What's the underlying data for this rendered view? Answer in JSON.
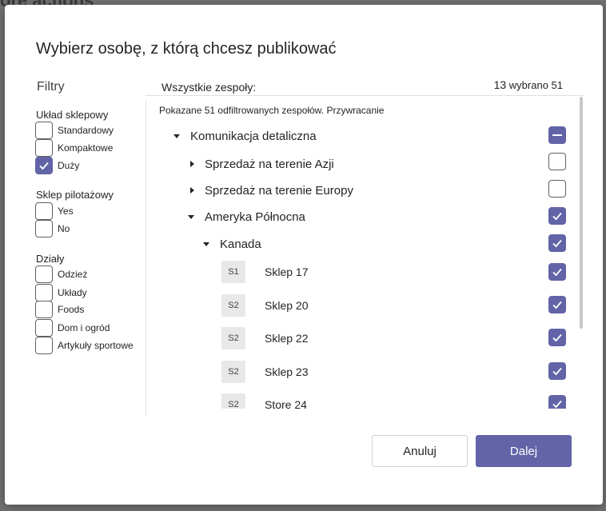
{
  "backdrop": {
    "text": "ore actions"
  },
  "dialog": {
    "title": "Wybierz osobę, z którą chcesz publikować",
    "filters": {
      "title": "Filtry",
      "groups": [
        {
          "title": "Układ sklepowy",
          "options": [
            {
              "label": "Standardowy",
              "checked": false
            },
            {
              "label": "Kompaktowe",
              "checked": false
            },
            {
              "label": "Duży",
              "checked": true
            }
          ]
        },
        {
          "title": "Sklep pilotażowy",
          "options": [
            {
              "label": "Yes",
              "checked": false
            },
            {
              "label": "No",
              "checked": false
            }
          ]
        },
        {
          "title": "Działy",
          "options": [
            {
              "label": "Odzież",
              "checked": false
            },
            {
              "label": "Układy",
              "checked": false
            },
            {
              "label": "Foods",
              "checked": false
            },
            {
              "label": "Dom i ogród",
              "checked": false
            },
            {
              "label": "Artykuły sportowe",
              "checked": false
            }
          ]
        }
      ]
    },
    "teams": {
      "header": "Wszystkie zespoły:",
      "selected_count": "13",
      "selected_suffix": "wybrano 51",
      "shown_info": "Pokazane 51 odfiltrowanych zespołów. Przywracanie",
      "tree": [
        {
          "label": "Komunikacja detaliczna",
          "state": "partial",
          "expanded": true
        },
        {
          "label": "Sprzedaż na terenie Azji",
          "state": "unchecked",
          "expanded": false
        },
        {
          "label": "Sprzedaż na terenie Europy",
          "state": "unchecked",
          "expanded": false
        },
        {
          "label": "Ameryka Północna",
          "state": "checked",
          "expanded": true
        },
        {
          "label": "Kanada",
          "state": "checked",
          "expanded": true
        }
      ],
      "stores": [
        {
          "badge": "S1",
          "label": "Sklep 17",
          "checked": true
        },
        {
          "badge": "S2",
          "label": "Sklep 20",
          "checked": true
        },
        {
          "badge": "S2",
          "label": "Sklep 22",
          "checked": true
        },
        {
          "badge": "S2",
          "label": "Sklep 23",
          "checked": true
        },
        {
          "badge": "S2",
          "label": "Store 24",
          "checked": true
        }
      ]
    },
    "buttons": {
      "cancel": "Anuluj",
      "next": "Dalej"
    }
  },
  "colors": {
    "accent": "#6264a7",
    "border": "#616161"
  }
}
